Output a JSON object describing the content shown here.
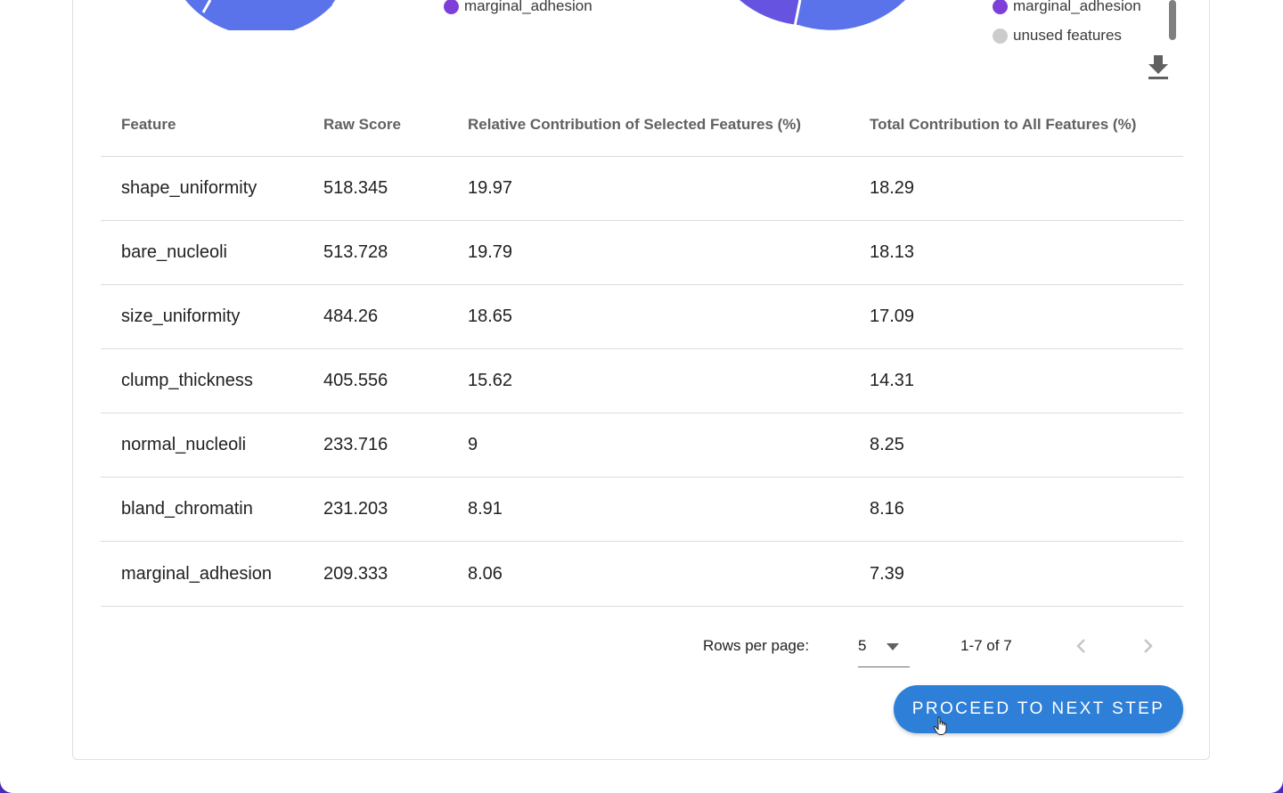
{
  "colors": {
    "accent": "#2d7fd8",
    "pie_blue": "#5b73ea",
    "pie_purple": "#6654e0",
    "legend_purple": "#7d3fd8",
    "legend_gray": "#cccccc"
  },
  "legend_left": {
    "items": [
      {
        "label": "marginal_adhesion",
        "color": "#7d3fd8"
      }
    ]
  },
  "legend_right": {
    "items": [
      {
        "label": "marginal_adhesion",
        "color": "#7d3fd8"
      },
      {
        "label": "unused features",
        "color": "#cccccc"
      }
    ]
  },
  "download_icon": "download-icon",
  "table": {
    "headers": [
      "Feature",
      "Raw Score",
      "Relative Contribution of Selected Features (%)",
      "Total Contribution to All Features (%)"
    ],
    "rows": [
      [
        "shape_uniformity",
        "518.345",
        "19.97",
        "18.29"
      ],
      [
        "bare_nucleoli",
        "513.728",
        "19.79",
        "18.13"
      ],
      [
        "size_uniformity",
        "484.26",
        "18.65",
        "17.09"
      ],
      [
        "clump_thickness",
        "405.556",
        "15.62",
        "14.31"
      ],
      [
        "normal_nucleoli",
        "233.716",
        "9",
        "8.25"
      ],
      [
        "bland_chromatin",
        "231.203",
        "8.91",
        "8.16"
      ],
      [
        "marginal_adhesion",
        "209.333",
        "8.06",
        "7.39"
      ]
    ]
  },
  "pagination": {
    "rows_per_page_label": "Rows per page:",
    "rows_per_page_value": "5",
    "range_text": "1-7 of 7"
  },
  "proceed_button": {
    "label": "PROCEED TO NEXT STEP"
  }
}
